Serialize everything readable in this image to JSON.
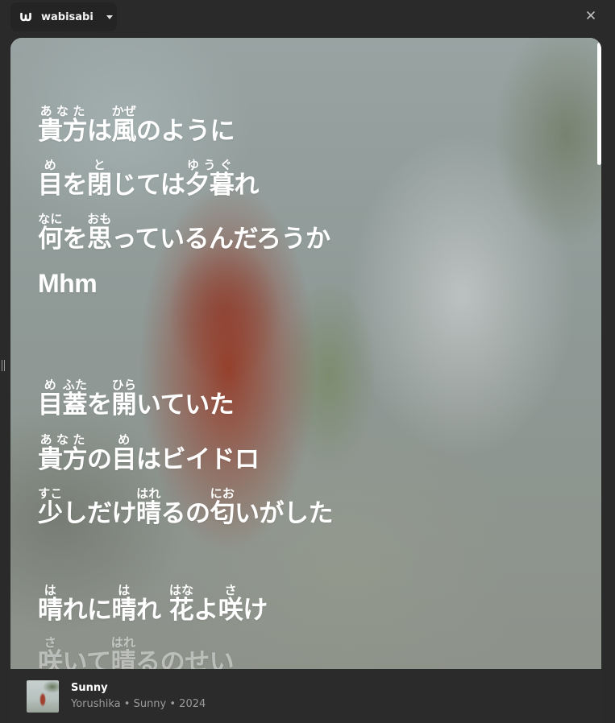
{
  "app": {
    "name": "wabisabi",
    "logo_icon": "wabisabi-logo-icon",
    "close_icon": "close-icon"
  },
  "lyrics": [
    [
      {
        "t": "貴方",
        "r": "あなた"
      },
      {
        "t": "は"
      },
      {
        "t": "風",
        "r": "かぜ"
      },
      {
        "t": "のように"
      }
    ],
    [
      {
        "t": "目",
        "r": "め"
      },
      {
        "t": "を"
      },
      {
        "t": "閉",
        "r": "と"
      },
      {
        "t": "じては"
      },
      {
        "t": "夕暮",
        "r": "ゆうぐ"
      },
      {
        "t": "れ"
      }
    ],
    [
      {
        "t": "何",
        "r": "なに"
      },
      {
        "t": "を"
      },
      {
        "t": "思",
        "r": "おも"
      },
      {
        "t": "っているんだろうか"
      }
    ],
    [
      {
        "t": "Mhm"
      }
    ],
    [
      {
        "t": "目",
        "r": "め"
      },
      {
        "t": "蓋",
        "r": "ふた"
      },
      {
        "t": "を"
      },
      {
        "t": "開",
        "r": "ひら"
      },
      {
        "t": "いていた"
      }
    ],
    [
      {
        "t": "貴方",
        "r": "あなた"
      },
      {
        "t": "の"
      },
      {
        "t": "目",
        "r": "め"
      },
      {
        "t": "はビイドロ"
      }
    ],
    [
      {
        "t": "少",
        "r": "すこ"
      },
      {
        "t": "しだけ"
      },
      {
        "t": "晴",
        "r": "はれ"
      },
      {
        "t": "るの"
      },
      {
        "t": "匂",
        "r": "にお"
      },
      {
        "t": "いがした"
      }
    ],
    [
      {
        "t": "晴",
        "r": "は"
      },
      {
        "t": "れに"
      },
      {
        "t": "晴",
        "r": "は"
      },
      {
        "t": "れ "
      },
      {
        "t": "花",
        "r": "はな"
      },
      {
        "t": "よ"
      },
      {
        "t": "咲",
        "r": "さ"
      },
      {
        "t": "け"
      }
    ],
    [
      {
        "t": "咲",
        "r": "さ"
      },
      {
        "t": "いて"
      },
      {
        "t": "晴",
        "r": "はれ"
      },
      {
        "t": "るのせい"
      }
    ]
  ],
  "now_playing": {
    "title": "Sunny",
    "meta": "Yorushika • Sunny • 2024"
  }
}
